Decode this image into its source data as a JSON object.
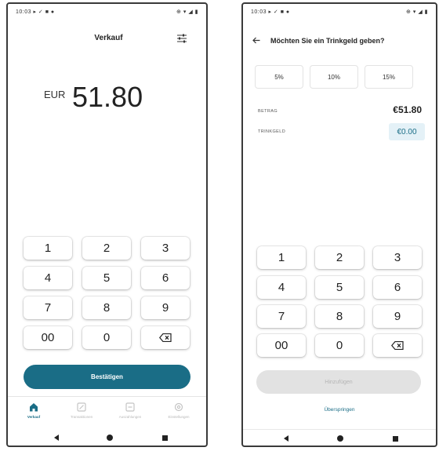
{
  "colors": {
    "accent": "#1a6d86",
    "tip_field_bg": "#e4f1f7",
    "disabled_btn": "#e2e2e2"
  },
  "left": {
    "status_left": "10:03 ▸ ✓ ■ ●",
    "status_right": "⊕ ▾ ◢ ▮",
    "title": "Verkauf",
    "settings_icon": "sliders-icon",
    "currency": "EUR",
    "amount": "51.80",
    "keypad": [
      "1",
      "2",
      "3",
      "4",
      "5",
      "6",
      "7",
      "8",
      "9",
      "00",
      "0",
      "⌫"
    ],
    "confirm_label": "Bestätigen",
    "nav": [
      {
        "label": "Verkauf",
        "icon": "home-icon",
        "active": true
      },
      {
        "label": "Transaktionen",
        "icon": "transactions-icon",
        "active": false
      },
      {
        "label": "Auszahlungen",
        "icon": "payouts-icon",
        "active": false
      },
      {
        "label": "Einstellungen",
        "icon": "settings-icon",
        "active": false
      }
    ]
  },
  "right": {
    "status_left": "10:03 ▸ ✓ ■ ●",
    "status_right": "⊕ ▾ ◢ ▮",
    "title": "Möchten Sie ein Trinkgeld geben?",
    "back_icon": "arrow-left-icon",
    "tip_options": [
      "5%",
      "10%",
      "15%"
    ],
    "betrag_label": "BETRAG",
    "betrag_value": "€51.80",
    "trinkgeld_label": "TRINKGELD",
    "trinkgeld_value": "€0.00",
    "keypad": [
      "1",
      "2",
      "3",
      "4",
      "5",
      "6",
      "7",
      "8",
      "9",
      "00",
      "0",
      "⌫"
    ],
    "confirm_label": "Hinzufügen",
    "skip_label": "Überspringen"
  }
}
